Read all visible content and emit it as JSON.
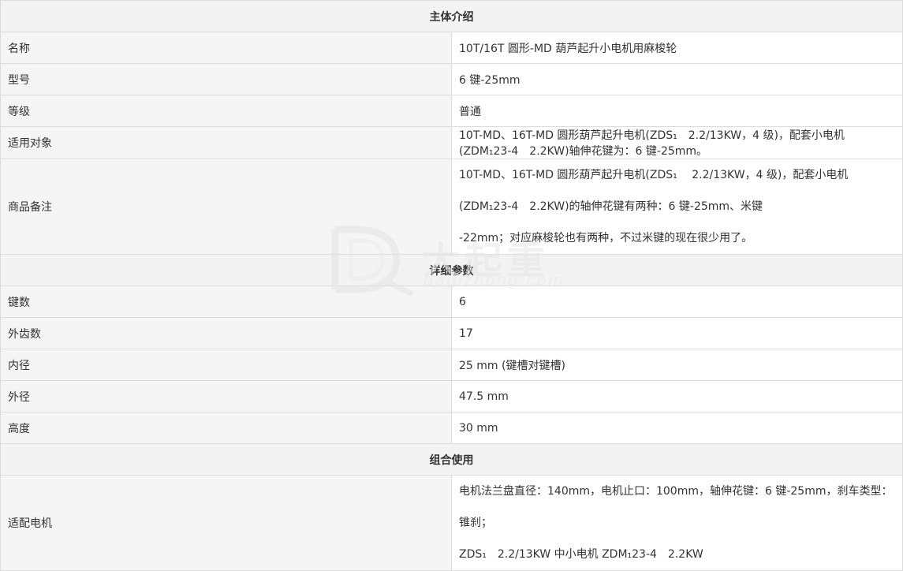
{
  "sections": {
    "main_intro": "主体介绍",
    "details": "详细参数",
    "combo": "组合使用"
  },
  "main_rows": [
    {
      "label": "名称",
      "value": "10T/16T 圆形-MD 葫芦起升小电机用麻梭轮"
    },
    {
      "label": "型号",
      "value": "6 键-25mm"
    },
    {
      "label": "等级",
      "value": "普通"
    },
    {
      "label": "适用对象",
      "value": "10T-MD、16T-MD 圆形葫芦起升电机(ZDS₁　2.2/13KW，4 级)，配套小电机(ZDM₁23-4　2.2KW)轴伸花键为：6 键-25mm。"
    },
    {
      "label": "商品备注",
      "lines": [
        "10T-MD、16T-MD 圆形葫芦起升电机(ZDS₁　 2.2/13KW，4 级)，配套小电机(ZDM₁23-4　2.2KW)的轴伸花键有两种：6 键-25mm、米键",
        "-22mm；对应麻梭轮也有两种，不过米键的现在很少用了。"
      ]
    }
  ],
  "detail_rows": [
    {
      "label": "键数",
      "value": "6"
    },
    {
      "label": "外齿数",
      "value": "17"
    },
    {
      "label": "内径",
      "value": "25 mm (键槽对键槽)"
    },
    {
      "label": "外径",
      "value": "47.5 mm"
    },
    {
      "label": "高度",
      "value": "30 mm"
    }
  ],
  "combo_rows": [
    {
      "label": "适配电机",
      "lines": [
        "电机法兰盘直径：140mm，电机止口：100mm，轴伸花键：6 键-25mm，刹车类型：锥刹；",
        "ZDS₁　2.2/13KW  中小电机 ZDM₁23-4　2.2KW"
      ]
    }
  ],
  "watermark": {
    "brand_text": "大起重",
    "url_text": "daqizhong.com"
  }
}
